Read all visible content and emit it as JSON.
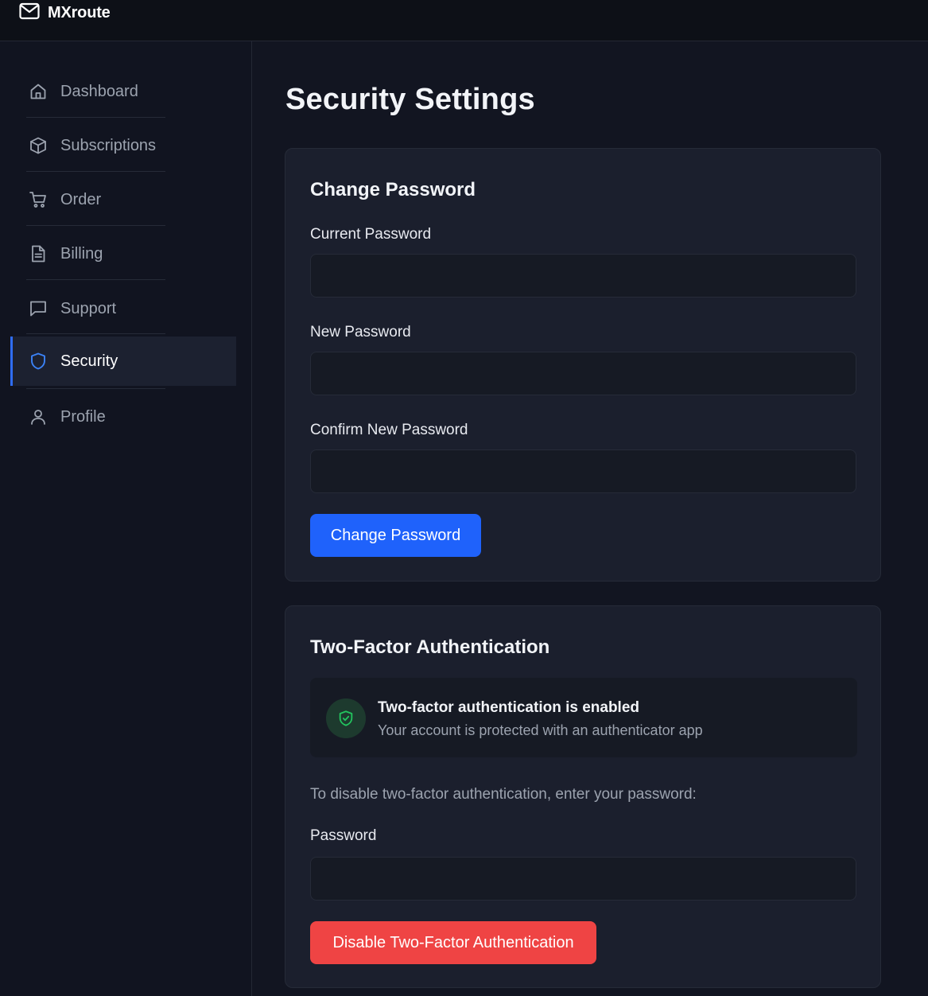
{
  "app": {
    "name": "MXroute",
    "logo_icon": "mail-icon"
  },
  "sidebar": {
    "items": [
      {
        "label": "Dashboard",
        "icon": "home-icon",
        "active": false
      },
      {
        "label": "Subscriptions",
        "icon": "box-icon",
        "active": false
      },
      {
        "label": "Order",
        "icon": "cart-icon",
        "active": false
      },
      {
        "label": "Billing",
        "icon": "document-icon",
        "active": false
      },
      {
        "label": "Support",
        "icon": "message-icon",
        "active": false
      },
      {
        "label": "Security",
        "icon": "shield-icon",
        "active": true
      },
      {
        "label": "Profile",
        "icon": "user-icon",
        "active": false
      }
    ]
  },
  "page": {
    "title": "Security Settings"
  },
  "change_password": {
    "title": "Change Password",
    "current_label": "Current Password",
    "current_value": "",
    "new_label": "New Password",
    "new_value": "",
    "confirm_label": "Confirm New Password",
    "confirm_value": "",
    "submit_label": "Change Password"
  },
  "two_factor": {
    "title": "Two-Factor Authentication",
    "status_title": "Two-factor authentication is enabled",
    "status_subtitle": "Your account is protected with an authenticator app",
    "status_icon": "shield-check-icon",
    "hint": "To disable two-factor authentication, enter your password:",
    "password_label": "Password",
    "password_value": "",
    "disable_label": "Disable Two-Factor Authentication"
  },
  "colors": {
    "accent": "#1f62fb",
    "danger": "#ef4444",
    "success": "#22c55e",
    "background": "#121521",
    "card": "#1b1f2d"
  }
}
